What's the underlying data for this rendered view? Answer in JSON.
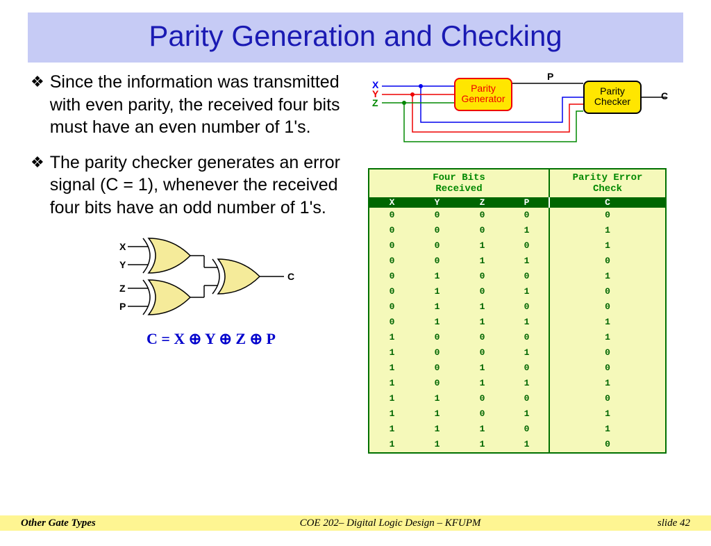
{
  "title": "Parity Generation and Checking",
  "bullets": [
    "Since the information was transmitted with even parity, the received four bits must have an even number of 1's.",
    "The parity checker generates an error signal (C = 1), whenever the received four bits have an odd number of 1's."
  ],
  "signals": {
    "x": "X",
    "y": "Y",
    "z": "Z",
    "p": "P",
    "c": "C"
  },
  "blocks": {
    "generator_l1": "Parity",
    "generator_l2": "Generator",
    "checker_l1": "Parity",
    "checker_l2": "Checker"
  },
  "equation": "C = X ⊕ Y ⊕ Z ⊕ P",
  "table": {
    "header_left_l1": "Four Bits",
    "header_left_l2": "Received",
    "header_right_l1": "Parity Error",
    "header_right_l2": "Check",
    "cols": {
      "x": "X",
      "y": "Y",
      "z": "Z",
      "p": "P",
      "c": "C"
    }
  },
  "chart_data": {
    "type": "table",
    "columns": [
      "X",
      "Y",
      "Z",
      "P",
      "C"
    ],
    "rows": [
      [
        0,
        0,
        0,
        0,
        0
      ],
      [
        0,
        0,
        0,
        1,
        1
      ],
      [
        0,
        0,
        1,
        0,
        1
      ],
      [
        0,
        0,
        1,
        1,
        0
      ],
      [
        0,
        1,
        0,
        0,
        1
      ],
      [
        0,
        1,
        0,
        1,
        0
      ],
      [
        0,
        1,
        1,
        0,
        0
      ],
      [
        0,
        1,
        1,
        1,
        1
      ],
      [
        1,
        0,
        0,
        0,
        1
      ],
      [
        1,
        0,
        0,
        1,
        0
      ],
      [
        1,
        0,
        1,
        0,
        0
      ],
      [
        1,
        0,
        1,
        1,
        1
      ],
      [
        1,
        1,
        0,
        0,
        0
      ],
      [
        1,
        1,
        0,
        1,
        1
      ],
      [
        1,
        1,
        1,
        0,
        1
      ],
      [
        1,
        1,
        1,
        1,
        0
      ]
    ]
  },
  "footer": {
    "left": "Other Gate Types",
    "center": "COE 202– Digital Logic  Design – KFUPM",
    "right": "slide 42"
  }
}
